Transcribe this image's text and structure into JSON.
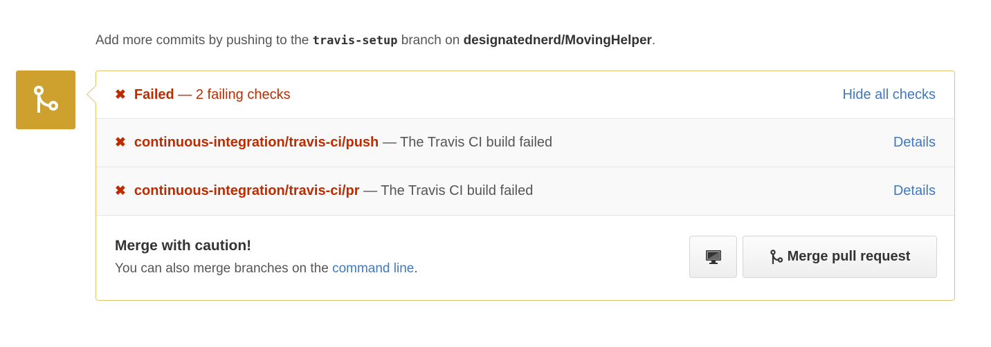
{
  "intro": {
    "prefix": "Add more commits by pushing to the",
    "branch": "travis-setup",
    "middle": "branch on",
    "repo": "designatednerd/MovingHelper",
    "suffix": "."
  },
  "status": {
    "x": "✖",
    "title": "Failed",
    "summary": "— 2 failing checks",
    "toggle_label": "Hide all checks"
  },
  "checks": [
    {
      "x": "✖",
      "name": "continuous-integration/travis-ci/push",
      "description": "— The Travis CI build failed",
      "link": "Details"
    },
    {
      "x": "✖",
      "name": "continuous-integration/travis-ci/pr",
      "description": "— The Travis CI build failed",
      "link": "Details"
    }
  ],
  "merge": {
    "heading": "Merge with caution!",
    "sub_prefix": "You can also merge branches on the",
    "sub_link": "command line",
    "sub_suffix": ".",
    "button_label": "Merge pull request"
  },
  "icons": {
    "merge_box": "git-merge-icon",
    "desktop": "desktop-icon",
    "button": "git-merge-icon"
  },
  "colors": {
    "merge_box": "#cea12f",
    "panel_border": "#e0c56a",
    "error": "#bd2c00",
    "link": "#4078c0"
  }
}
